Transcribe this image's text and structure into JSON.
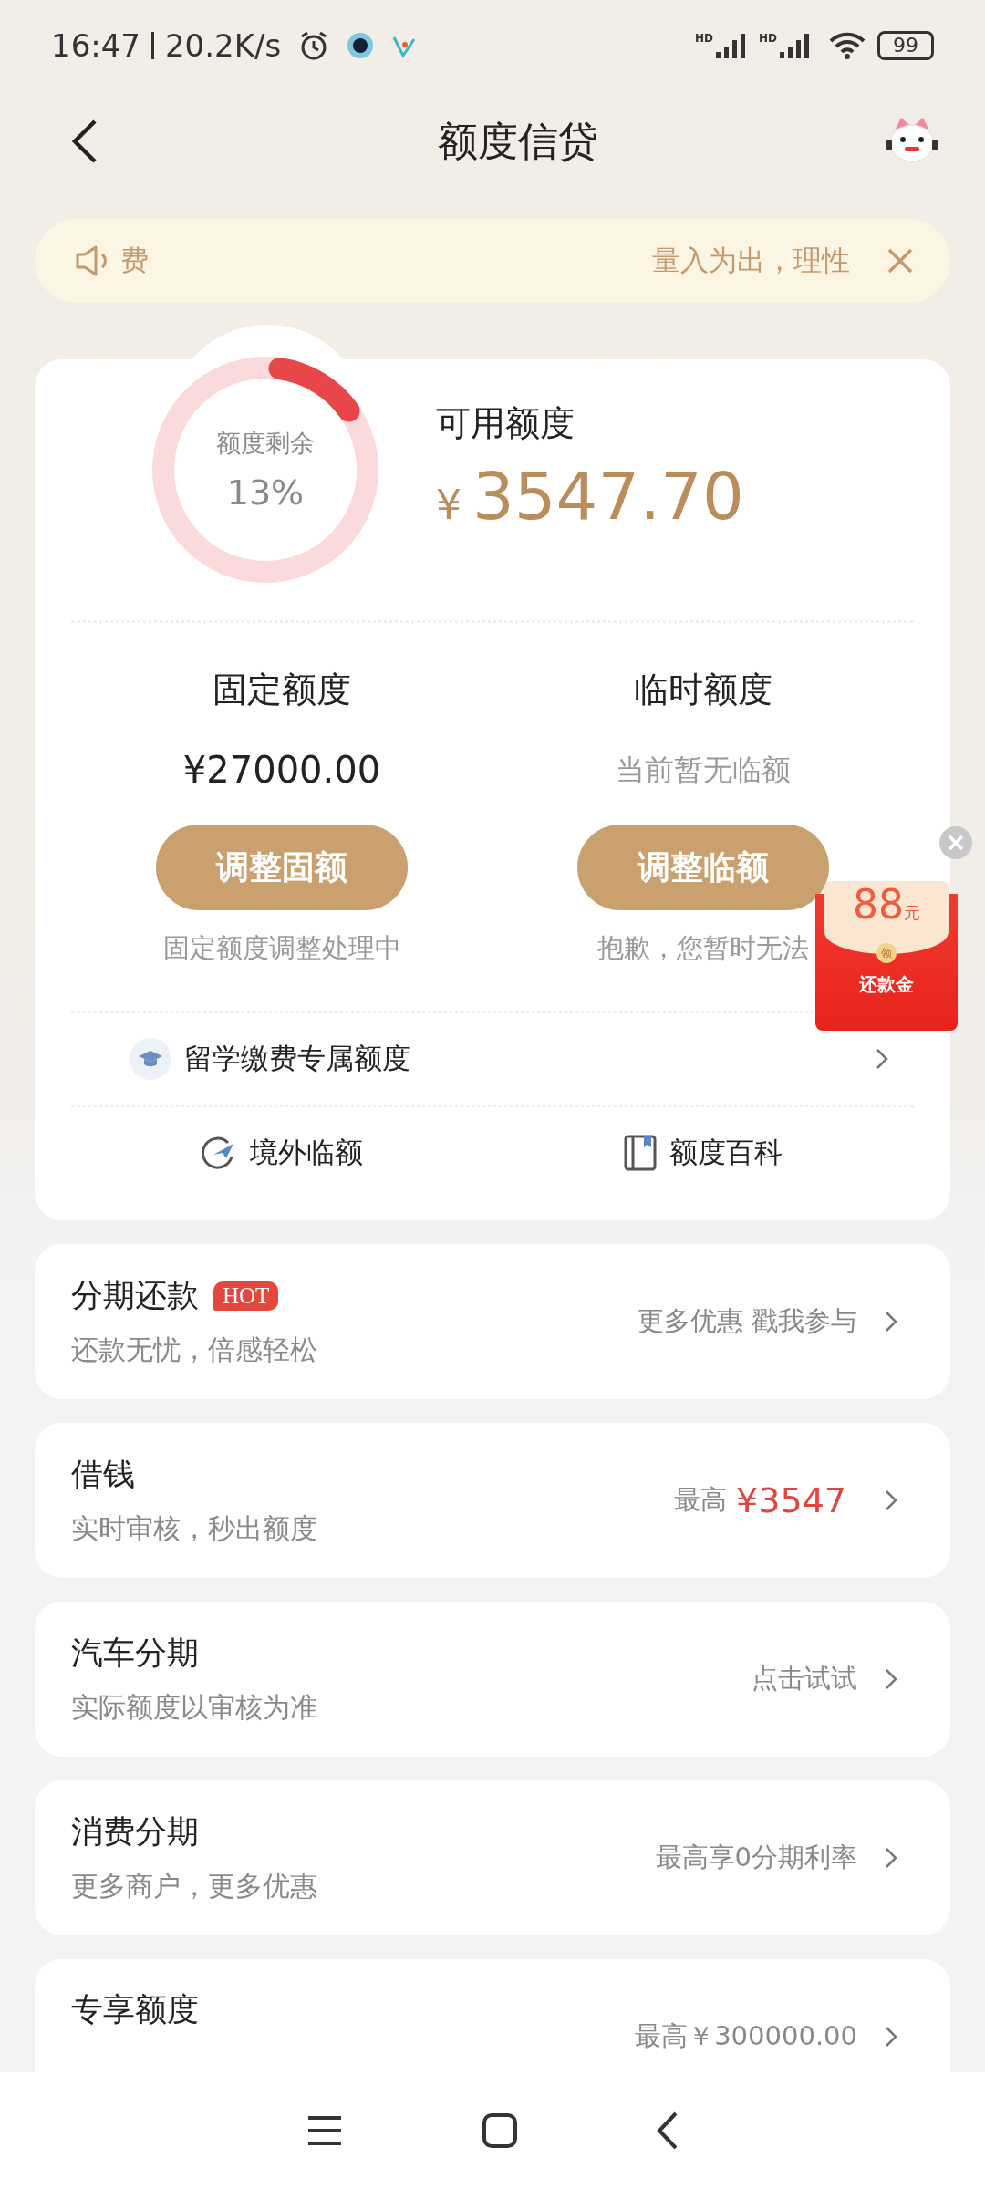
{
  "status_bar": {
    "time": "16:47",
    "speed": "20.2K/s",
    "battery": "99",
    "network_labels": [
      "HD",
      "HD"
    ]
  },
  "nav": {
    "title": "额度信贷"
  },
  "notice": {
    "lead": "费",
    "text": "量入为出，理性"
  },
  "credit": {
    "ring_label": "额度剩余",
    "ring_percent": "13%",
    "level": 0.13,
    "available_label": "可用额度",
    "currency": "¥",
    "available_amount": "3547.70",
    "columns": [
      {
        "title": "固定额度",
        "value": "¥27000.00",
        "muted": false,
        "button": "调整固额",
        "note": "固定额度调整处理中"
      },
      {
        "title": "临时额度",
        "value": "当前暂无临额",
        "muted": true,
        "button": "调整临额",
        "note": "抱歉，您暂时无法"
      }
    ],
    "special_row": "留学缴费专属额度",
    "links": [
      {
        "label": "境外临额",
        "kind": "plane"
      },
      {
        "label": "额度百科",
        "kind": "book"
      }
    ]
  },
  "products": [
    {
      "title": "分期还款",
      "badge": "HOT",
      "subtitle": "还款无忧，倍感轻松",
      "right": "更多优惠 戳我参与"
    },
    {
      "title": "借钱",
      "subtitle": "实时审核，秒出额度",
      "right": "最高",
      "right_accent": "¥3547"
    },
    {
      "title": "汽车分期",
      "subtitle": "实际额度以审核为准",
      "right": "点击试试"
    },
    {
      "title": "消费分期",
      "subtitle": "更多商户，更多优惠",
      "right": "最高享0分期利率"
    },
    {
      "title": "专享额度",
      "right": "最高￥300000.00"
    }
  ],
  "float_reward": {
    "amount": "88",
    "unit": "元",
    "seal": "领",
    "label": "还款金"
  }
}
